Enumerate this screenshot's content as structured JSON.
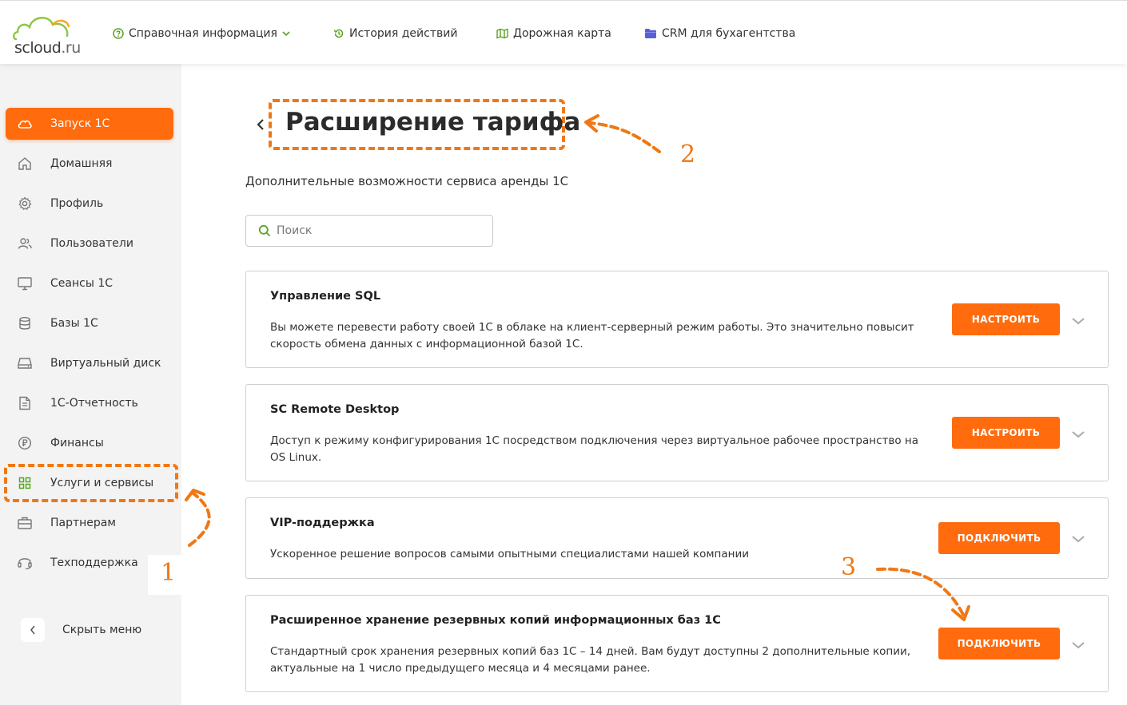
{
  "header": {
    "logo": {
      "name": "scloud",
      "tld": ".ru"
    },
    "nav": [
      {
        "label": "Справочная информация",
        "icon": "help-circle-icon",
        "has_dropdown": true
      },
      {
        "label": "История действий",
        "icon": "history-icon"
      },
      {
        "label": "Дорожная карта",
        "icon": "map-icon"
      },
      {
        "label": "CRM для бухагентства",
        "icon": "folder-icon"
      }
    ]
  },
  "sidebar": {
    "items": [
      {
        "label": "Запуск 1С",
        "icon": "cloud-icon",
        "active": true
      },
      {
        "label": "Домашняя",
        "icon": "home-icon"
      },
      {
        "label": "Профиль",
        "icon": "gear-icon"
      },
      {
        "label": "Пользователи",
        "icon": "users-icon"
      },
      {
        "label": "Сеансы 1С",
        "icon": "monitor-icon"
      },
      {
        "label": "Базы 1С",
        "icon": "database-icon"
      },
      {
        "label": "Виртуальный диск",
        "icon": "disk-icon"
      },
      {
        "label": "1С-Отчетность",
        "icon": "document-icon"
      },
      {
        "label": "Финансы",
        "icon": "ruble-icon"
      },
      {
        "label": "Услуги и сервисы",
        "icon": "grid-icon",
        "highlighted": true
      },
      {
        "label": "Партнерам",
        "icon": "briefcase-icon"
      },
      {
        "label": "Техподдержка",
        "icon": "headset-icon"
      }
    ],
    "hide_menu_label": "Скрыть меню"
  },
  "main": {
    "title": "Расширение тарифа",
    "subtitle": "Дополнительные возможности сервиса аренды 1С",
    "search_placeholder": "Поиск",
    "cards": [
      {
        "title": "Управление SQL",
        "description": "Вы можете перевести работу своей 1С в облаке на клиент-серверный режим работы. Это значительно повысит скорость обмена данных с информационной базой 1С.",
        "button": "НАСТРОИТЬ"
      },
      {
        "title": "SC Remote Desktop",
        "description": "Доступ к режиму конфигурирования 1С посредством подключения через виртуальное рабочее пространство на OS Linux.",
        "button": "НАСТРОИТЬ"
      },
      {
        "title": "VIP-поддержка",
        "description": "Ускоренное решение вопросов самыми опытными специалистами нашей компании",
        "button": "ПОДКЛЮЧИТЬ"
      },
      {
        "title": "Расширенное хранение резервных копий информационных баз 1С",
        "description": "Стандартный срок хранения резервных копий баз 1С – 14 дней. Вам будут доступны 2 дополнительные копии, актуальные на 1 число предыдущего месяца и 4 месяцами ранее.",
        "button": "ПОДКЛЮЧИТЬ"
      }
    ]
  },
  "annotations": {
    "step1": "1",
    "step2": "2",
    "step3": "3"
  },
  "colors": {
    "accent": "#ff6b0d",
    "annotation": "#f07814",
    "icon_green": "#5aa31f",
    "crm_folder": "#5b5fd6",
    "sidebar_bg": "#f3f3f3"
  }
}
